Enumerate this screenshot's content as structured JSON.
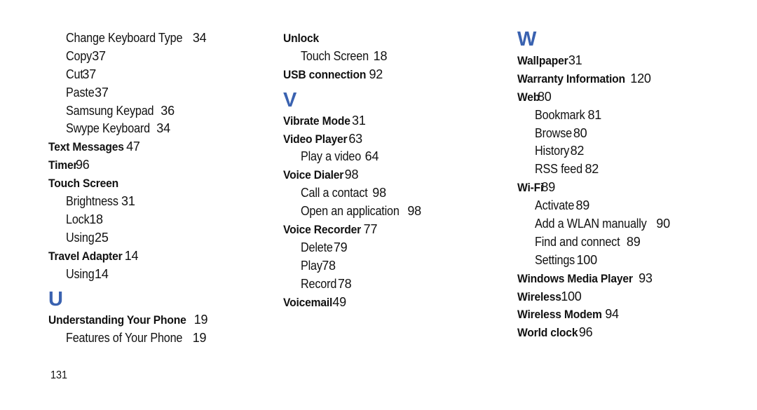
{
  "page_number": "131",
  "accent_color": "#3a62b0",
  "columns": [
    [
      {
        "type": "sub",
        "term": "Change Keyboard Type",
        "pages": "34"
      },
      {
        "type": "sub",
        "term": "Copy",
        "pages": "37"
      },
      {
        "type": "sub",
        "term": "Cut",
        "pages": "37"
      },
      {
        "type": "sub",
        "term": "Paste",
        "pages": "37"
      },
      {
        "type": "sub",
        "term": "Samsung Keypad",
        "pages": "36"
      },
      {
        "type": "sub",
        "term": "Swype Keyboard",
        "pages": "34"
      },
      {
        "type": "main",
        "term": "Text Messages",
        "pages": "47"
      },
      {
        "type": "main",
        "term": "Timer",
        "pages": "96"
      },
      {
        "type": "main",
        "term": "Touch Screen",
        "pages": ""
      },
      {
        "type": "sub",
        "term": "Brightness",
        "pages": "31"
      },
      {
        "type": "sub",
        "term": "Lock",
        "pages": "18"
      },
      {
        "type": "sub",
        "term": "Using",
        "pages": "25"
      },
      {
        "type": "main",
        "term": "Travel Adapter",
        "pages": "14"
      },
      {
        "type": "sub",
        "term": "Using",
        "pages": "14"
      },
      {
        "type": "letter",
        "term": "U"
      },
      {
        "type": "main",
        "term": "Understanding Your Phone",
        "pages": "19"
      },
      {
        "type": "sub",
        "term": "Features of Your Phone",
        "pages": "19"
      }
    ],
    [
      {
        "type": "main",
        "term": "Unlock",
        "pages": ""
      },
      {
        "type": "sub",
        "term": "Touch Screen",
        "pages": "18"
      },
      {
        "type": "main",
        "term": "USB connection",
        "pages": "92"
      },
      {
        "type": "letter",
        "term": "V"
      },
      {
        "type": "main",
        "term": "Vibrate Mode",
        "pages": "31"
      },
      {
        "type": "main",
        "term": "Video Player",
        "pages": "63"
      },
      {
        "type": "sub",
        "term": "Play a video",
        "pages": "64"
      },
      {
        "type": "main",
        "term": "Voice Dialer",
        "pages": "98"
      },
      {
        "type": "sub",
        "term": "Call a contact",
        "pages": "98"
      },
      {
        "type": "sub",
        "term": "Open an application",
        "pages": "98"
      },
      {
        "type": "main",
        "term": "Voice Recorder",
        "pages": "77"
      },
      {
        "type": "sub",
        "term": "Delete",
        "pages": "79"
      },
      {
        "type": "sub",
        "term": "Play",
        "pages": "78"
      },
      {
        "type": "sub",
        "term": "Record",
        "pages": "78"
      },
      {
        "type": "main",
        "term": "Voicemail",
        "pages": "49"
      }
    ],
    [
      {
        "type": "letter",
        "term": "W",
        "first": true
      },
      {
        "type": "main",
        "term": "Wallpaper",
        "pages": "31"
      },
      {
        "type": "main",
        "term": "Warranty Information",
        "pages": "120"
      },
      {
        "type": "main",
        "term": "Web",
        "pages": "80"
      },
      {
        "type": "sub",
        "term": "Bookmark",
        "pages": "81"
      },
      {
        "type": "sub",
        "term": "Browse",
        "pages": "80"
      },
      {
        "type": "sub",
        "term": "History",
        "pages": "82"
      },
      {
        "type": "sub",
        "term": "RSS feed",
        "pages": "82"
      },
      {
        "type": "main",
        "term": "Wi-Fi",
        "pages": "89"
      },
      {
        "type": "sub",
        "term": "Activate",
        "pages": "89"
      },
      {
        "type": "sub",
        "term": "Add a WLAN manually",
        "pages": "90"
      },
      {
        "type": "sub",
        "term": "Find and connect",
        "pages": "89"
      },
      {
        "type": "sub",
        "term": "Settings",
        "pages": "100"
      },
      {
        "type": "main",
        "term": "Windows Media Player",
        "pages": "93"
      },
      {
        "type": "main",
        "term": "Wireless",
        "pages": "100"
      },
      {
        "type": "main",
        "term": "Wireless Modem",
        "pages": "94"
      },
      {
        "type": "main",
        "term": "World clock",
        "pages": "96"
      }
    ]
  ]
}
